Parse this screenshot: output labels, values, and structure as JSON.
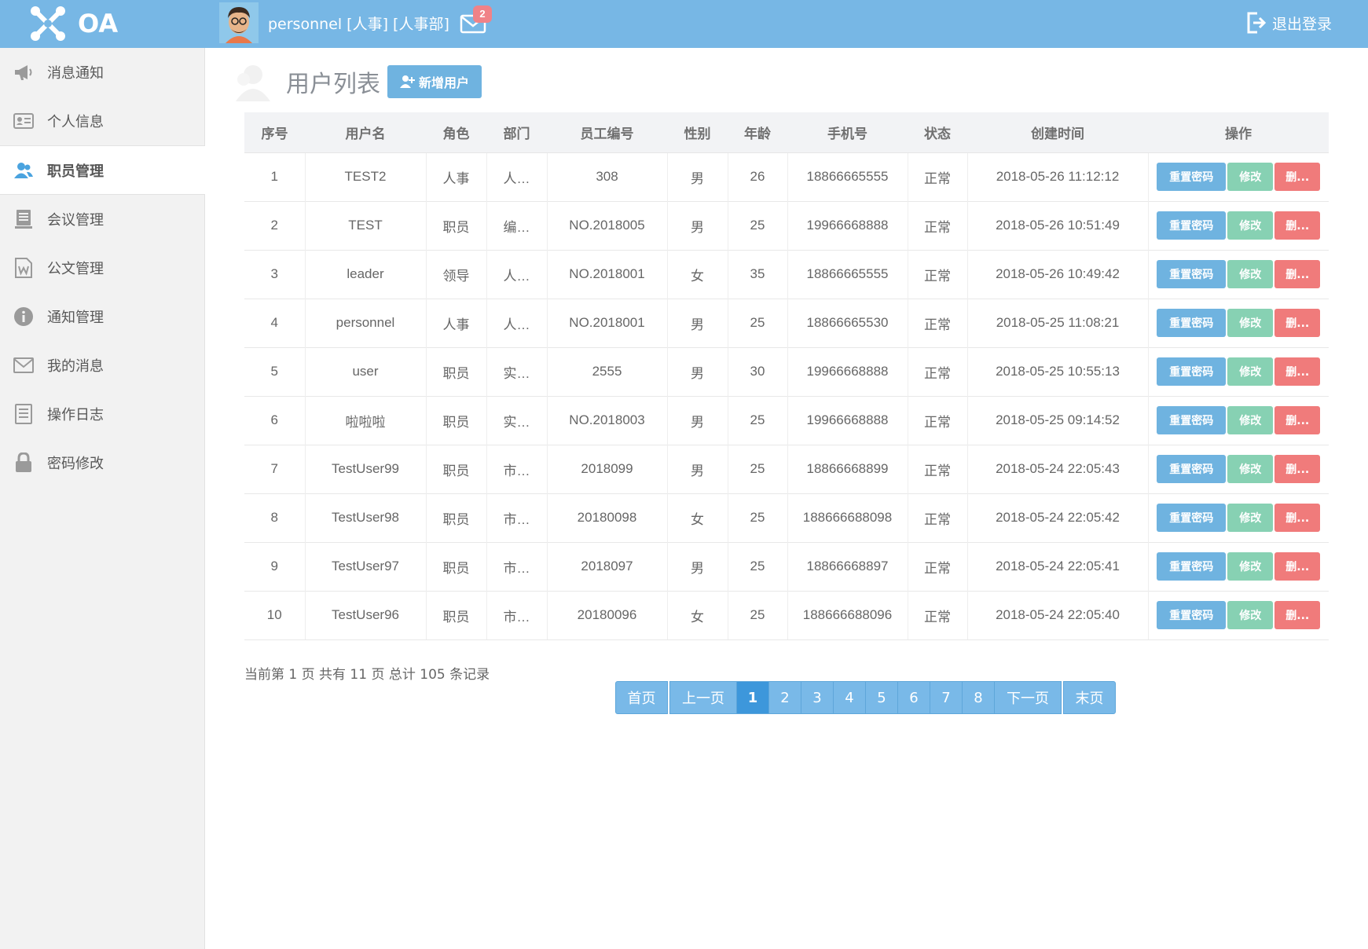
{
  "header": {
    "logo_text": "OA",
    "user_label": "personnel [人事] [人事部]",
    "mail_badge": "2",
    "logout_label": "退出登录"
  },
  "sidebar": {
    "items": [
      {
        "label": "消息通知",
        "icon": "megaphone-icon"
      },
      {
        "label": "个人信息",
        "icon": "id-card-icon"
      },
      {
        "label": "职员管理",
        "icon": "users-icon",
        "active": true
      },
      {
        "label": "会议管理",
        "icon": "document-stack-icon"
      },
      {
        "label": "公文管理",
        "icon": "word-doc-icon"
      },
      {
        "label": "通知管理",
        "icon": "info-icon"
      },
      {
        "label": "我的消息",
        "icon": "envelope-icon"
      },
      {
        "label": "操作日志",
        "icon": "list-icon"
      },
      {
        "label": "密码修改",
        "icon": "lock-icon"
      }
    ]
  },
  "main": {
    "title": "用户列表",
    "add_button": "新增用户",
    "columns": [
      "序号",
      "用户名",
      "角色",
      "部门",
      "员工编号",
      "性别",
      "年龄",
      "手机号",
      "状态",
      "创建时间",
      "操作"
    ],
    "rows": [
      [
        "1",
        "TEST2",
        "人事",
        "人…",
        "308",
        "男",
        "26",
        "18866665555",
        "正常",
        "2018-05-26 11:12:12"
      ],
      [
        "2",
        "TEST",
        "职员",
        "编…",
        "NO.2018005",
        "男",
        "25",
        "19966668888",
        "正常",
        "2018-05-26 10:51:49"
      ],
      [
        "3",
        "leader",
        "领导",
        "人…",
        "NO.2018001",
        "女",
        "35",
        "18866665555",
        "正常",
        "2018-05-26 10:49:42"
      ],
      [
        "4",
        "personnel",
        "人事",
        "人…",
        "NO.2018001",
        "男",
        "25",
        "18866665530",
        "正常",
        "2018-05-25 11:08:21"
      ],
      [
        "5",
        "user",
        "职员",
        "实…",
        "2555",
        "男",
        "30",
        "19966668888",
        "正常",
        "2018-05-25 10:55:13"
      ],
      [
        "6",
        "啦啦啦",
        "职员",
        "实…",
        "NO.2018003",
        "男",
        "25",
        "19966668888",
        "正常",
        "2018-05-25 09:14:52"
      ],
      [
        "7",
        "TestUser99",
        "职员",
        "市…",
        "2018099",
        "男",
        "25",
        "18866668899",
        "正常",
        "2018-05-24 22:05:43"
      ],
      [
        "8",
        "TestUser98",
        "职员",
        "市…",
        "20180098",
        "女",
        "25",
        "188666688098",
        "正常",
        "2018-05-24 22:05:42"
      ],
      [
        "9",
        "TestUser97",
        "职员",
        "市…",
        "2018097",
        "男",
        "25",
        "18866668897",
        "正常",
        "2018-05-24 22:05:41"
      ],
      [
        "10",
        "TestUser96",
        "职员",
        "市…",
        "20180096",
        "女",
        "25",
        "188666688096",
        "正常",
        "2018-05-24 22:05:40"
      ]
    ],
    "row_actions": {
      "reset": "重置密码",
      "edit": "修改",
      "delete": "删..."
    },
    "summary": "当前第 1 页 共有 11 页 总计 105 条记录",
    "pagination": {
      "first": "首页",
      "prev": "上一页",
      "pages": [
        "1",
        "2",
        "3",
        "4",
        "5",
        "6",
        "7",
        "8"
      ],
      "current": "1",
      "next": "下一页",
      "last": "末页"
    }
  },
  "colors": {
    "topbar": "#77b7e5",
    "primary_button": "#6fb3e0",
    "edit_button": "#87d1b3",
    "delete_button": "#f07b7b",
    "badge": "#f08288"
  }
}
